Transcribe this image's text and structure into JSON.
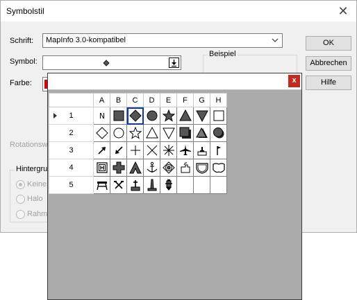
{
  "dialog": {
    "title": "Symbolstil",
    "close_glyph": "✕",
    "font_label": "Schrift:",
    "font_value": "MapInfo 3.0-kompatibel",
    "symbol_label": "Symbol:",
    "color_label": "Farbe:",
    "color_value": "#e00000",
    "preview_label": "Beispiel",
    "rotation_label": "Rotationswi",
    "background_group_label": "Hintergrur",
    "radio_options": [
      "Keine",
      "Halo",
      "Rahme"
    ],
    "radio_selected": "Keine",
    "buttons": {
      "ok": "OK",
      "cancel": "Abbrechen",
      "help": "Hilfe"
    }
  },
  "popup": {
    "close_glyph": "x",
    "columns": [
      "A",
      "B",
      "C",
      "D",
      "E",
      "F",
      "G",
      "H"
    ],
    "rows": [
      {
        "label": "1",
        "cells": [
          "letter-n",
          "filled-square",
          "filled-diamond",
          "filled-circle",
          "filled-star",
          "filled-triangle",
          "filled-triangle-down",
          "open-square"
        ]
      },
      {
        "label": "2",
        "cells": [
          "open-diamond",
          "open-circle",
          "open-star",
          "open-triangle",
          "open-triangle-down",
          "shadow-square",
          "shadow-triangle",
          "shadow-circle"
        ]
      },
      {
        "label": "3",
        "cells": [
          "arrow-ne",
          "arrow-sw",
          "plus-thin",
          "x-thin",
          "asterisk",
          "airplane-icon",
          "hut-icon",
          "flag-icon"
        ]
      },
      {
        "label": "4",
        "cells": [
          "building-h-icon",
          "first-aid-cross-icon",
          "tent-icon",
          "anchor-icon",
          "target-diamond-icon",
          "house-outline-icon",
          "shield-badge-icon",
          "highway-badge-icon"
        ]
      },
      {
        "label": "5",
        "cells": [
          "picnic-table-icon",
          "crossed-tools-icon",
          "grave-cross-icon",
          "monument-icon",
          "fire-hydrant-icon",
          "",
          "",
          ""
        ]
      }
    ],
    "selected": {
      "row": "1",
      "col": "C"
    },
    "current_row": "1"
  }
}
